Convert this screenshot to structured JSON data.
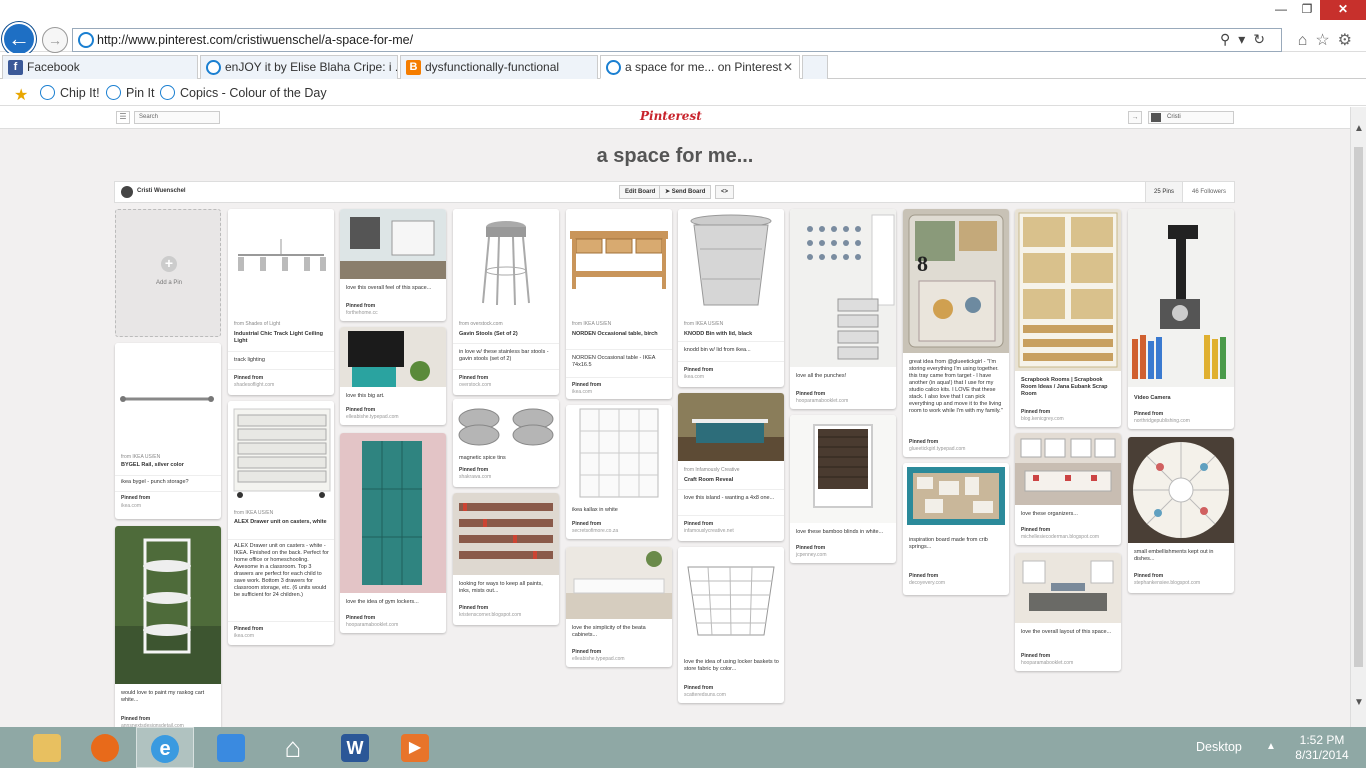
{
  "browser": {
    "url": "http://www.pinterest.com/cristiwuenschel/a-space-for-me/",
    "tabs": [
      {
        "label": "Facebook",
        "icon": "facebook-icon",
        "active": false
      },
      {
        "label": "enJOY it by Elise Blaha Cripe: i ...",
        "icon": "ie-page-icon",
        "active": false
      },
      {
        "label": "dysfunctionally-functional",
        "icon": "blogger-icon",
        "active": false
      },
      {
        "label": "a space for me... on Pinterest",
        "icon": "ie-page-icon",
        "active": true
      }
    ],
    "favorites": [
      "Chip It!",
      "Pin It",
      "Copics - Colour of the Day"
    ]
  },
  "pinterest": {
    "search_placeholder": "Search",
    "logo": "Pinterest",
    "user_name": "Cristi",
    "board_title": "a space for me...",
    "owner": "Cristi Wuenschel",
    "edit_board": "Edit Board",
    "send_board": "Send Board",
    "embed": "<>",
    "pins_count": "25 Pins",
    "followers_count": "46 Followers",
    "add_pin": "Add a Pin"
  },
  "pins": [
    {
      "id": "p1",
      "from": "from IKEA US/EN",
      "title": "BYGEL Rail, silver color",
      "desc": "ikea bygel - punch storage?",
      "pinned": "Pinned from",
      "src": "ikea.com"
    },
    {
      "id": "p2",
      "from": "",
      "title": "",
      "desc": "would love to paint my raskog cart white...",
      "pinned": "Pinned from",
      "src": "annsnextsdesignsdetail.com"
    },
    {
      "id": "p3",
      "from": "from Shades of Light",
      "title": "Industrial Chic Track Light Ceiling Light",
      "desc": "track lighting",
      "pinned": "Pinned from",
      "src": "shadesoflight.com"
    },
    {
      "id": "p4",
      "from": "from IKEA US/EN",
      "title": "ALEX Drawer unit on casters, white",
      "desc": "ALEX Drawer unit on casters - white - IKEA. Finished on the back. Perfect for home office or homeschooling. Awesome in a classroom. Top 3 drawers are perfect for each child to save work. Bottom 3 drawers for classroom storage, etc. (6 units would be sufficient for 24 children.)",
      "pinned": "Pinned from",
      "src": "ikea.com"
    },
    {
      "id": "p5",
      "from": "",
      "title": "",
      "desc": "love this overall feel of this space...",
      "pinned": "Pinned from",
      "src": "forthehome.cc"
    },
    {
      "id": "p6",
      "from": "",
      "title": "",
      "desc": "love this big art.",
      "pinned": "Pinned from",
      "src": "elleabishe.typepad.com"
    },
    {
      "id": "p7",
      "from": "",
      "title": "",
      "desc": "love the idea of gym lockers...",
      "pinned": "Pinned from",
      "src": "hooparamabooklet.com"
    },
    {
      "id": "p8",
      "from": "from overstock.com",
      "title": "Gavin Stools (Set of 2)",
      "desc": "in love w/ these stainless bar stools - gavin stools (set of 2)",
      "pinned": "Pinned from",
      "src": "overstock.com"
    },
    {
      "id": "p9",
      "from": "",
      "title": "",
      "desc": "magnetic spice tins",
      "pinned": "Pinned from",
      "src": "shakrawa.com"
    },
    {
      "id": "p10",
      "from": "",
      "title": "",
      "desc": "looking for ways to keep all paints, inks, mists out...",
      "pinned": "Pinned from",
      "src": "kristenscorner.blogspot.com"
    },
    {
      "id": "p11",
      "from": "from IKEA US/EN",
      "title": "NORDEN Occasional table, birch",
      "desc": "NORDEN Occasional table - IKEA 74x16.5",
      "pinned": "Pinned from",
      "src": "ikea.com"
    },
    {
      "id": "p12",
      "from": "",
      "title": "",
      "desc": "ikea kallax in white",
      "pinned": "Pinned from",
      "src": "secretsofimore.co.za"
    },
    {
      "id": "p13",
      "from": "",
      "title": "",
      "desc": "love the simplicity of the beata cabinets...",
      "pinned": "Pinned from",
      "src": "elleabishe.typepad.com"
    },
    {
      "id": "p14",
      "from": "from IKEA US/EN",
      "title": "KNODD Bin with lid, black",
      "desc": "knodd bin w/ lid from ikea...",
      "pinned": "Pinned from",
      "src": "ikea.com"
    },
    {
      "id": "p15",
      "from": "from Infamously Creative",
      "title": "Craft Room Reveal",
      "desc": "love this island - wanting a 4x8 one...",
      "pinned": "Pinned from",
      "src": "infamouslycreative.net"
    },
    {
      "id": "p16",
      "from": "",
      "title": "",
      "desc": "love the idea of using locker baskets to store fabric by color...",
      "pinned": "Pinned from",
      "src": "scatteredsuns.com"
    },
    {
      "id": "p17",
      "from": "",
      "title": "",
      "desc": "love all the punches!",
      "pinned": "Pinned from",
      "src": "hooparamabooklet.com"
    },
    {
      "id": "p18",
      "from": "",
      "title": "",
      "desc": "love these bamboo blinds in white...",
      "pinned": "Pinned from",
      "src": "jcpenney.com"
    },
    {
      "id": "p19",
      "from": "",
      "title": "",
      "desc": "great idea from @glueetickgirl - \"I'm storing everything I'm using together. this tray came from target - I have another (in aqua!) that I use for my studio calico kits. I LOVE that these stack. I also love that I can pick everything up and move it to the living room to work while I'm with my family.\"",
      "pinned": "Pinned from",
      "src": "glueetickgirl.typepad.com"
    },
    {
      "id": "p20",
      "from": "",
      "title": "",
      "desc": "inspiration board made from crib springs...",
      "pinned": "Pinned from",
      "src": "decoyevery.com"
    },
    {
      "id": "p21",
      "from": "",
      "title": "Scrapbook Rooms | Scrapbook Room Ideas / Jana Eubank Scrap Room",
      "desc": "",
      "pinned": "Pinned from",
      "src": "blog.kenicgrey.com"
    },
    {
      "id": "p22",
      "from": "",
      "title": "",
      "desc": "love these organizers...",
      "pinned": "Pinned from",
      "src": "michellesiecoderman.blogspot.com"
    },
    {
      "id": "p23",
      "from": "",
      "title": "",
      "desc": "love the overall layout of this space...",
      "pinned": "Pinned from",
      "src": "hooparamabooklet.com"
    },
    {
      "id": "p24",
      "from": "",
      "title": "Video Camera",
      "desc": "",
      "pinned": "Pinned from",
      "src": "northridgepublishing.com"
    },
    {
      "id": "p25",
      "from": "",
      "title": "",
      "desc": "small embellishments kept out in dishes...",
      "pinned": "Pinned from",
      "src": "stephankensiee.blogspot.com"
    }
  ],
  "taskbar": {
    "desktop": "Desktop",
    "time": "1:52 PM",
    "date": "8/31/2014"
  },
  "colors": {
    "pinterest_red": "#c8232c",
    "ie_blue": "#1e6fc4",
    "taskbar": "#8fa8a5",
    "page_bg": "#f2f0f0"
  }
}
